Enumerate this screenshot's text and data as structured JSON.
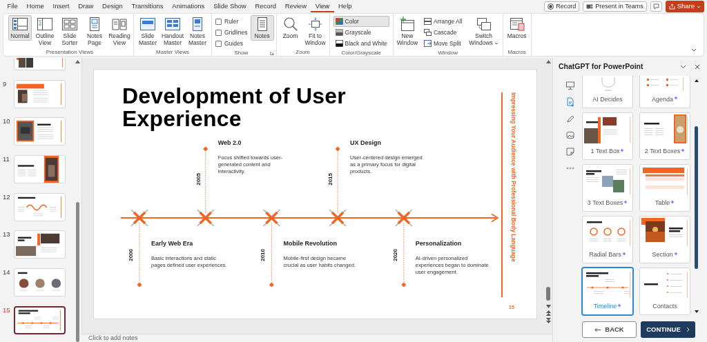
{
  "menu_tabs": [
    {
      "label": "File",
      "selected": false
    },
    {
      "label": "Home",
      "selected": false
    },
    {
      "label": "Insert",
      "selected": false
    },
    {
      "label": "Draw",
      "selected": false
    },
    {
      "label": "Design",
      "selected": false
    },
    {
      "label": "Transitions",
      "selected": false
    },
    {
      "label": "Animations",
      "selected": false
    },
    {
      "label": "Slide Show",
      "selected": false
    },
    {
      "label": "Record",
      "selected": false
    },
    {
      "label": "Review",
      "selected": false
    },
    {
      "label": "View",
      "selected": true
    },
    {
      "label": "Help",
      "selected": false
    }
  ],
  "title_actions": [
    {
      "kind": "record",
      "label": "Record"
    },
    {
      "kind": "teams",
      "label": "Present in Teams"
    },
    {
      "kind": "comment"
    },
    {
      "kind": "share",
      "label": "Share"
    }
  ],
  "ribbon": [
    {
      "label": "Presentation Views",
      "items": [
        {
          "kind": "large",
          "label": "Normal",
          "selected": true
        },
        {
          "kind": "large",
          "label": "Outline View",
          "selected": false
        },
        {
          "kind": "large",
          "label": "Slide Sorter",
          "selected": false
        },
        {
          "kind": "large",
          "label": "Notes Page",
          "selected": false
        },
        {
          "kind": "large",
          "label": "Reading View",
          "selected": false
        }
      ]
    },
    {
      "label": "Master Views",
      "items": [
        {
          "kind": "large",
          "label": "Slide Master",
          "selected": false
        },
        {
          "kind": "large",
          "label": "Handout Master",
          "selected": false
        },
        {
          "kind": "large",
          "label": "Notes Master",
          "selected": false
        }
      ]
    },
    {
      "label": "Show",
      "launcher": true,
      "items": [
        {
          "kind": "check",
          "label": "Ruler",
          "checked": false
        },
        {
          "kind": "check",
          "label": "Gridlines",
          "checked": false
        },
        {
          "kind": "check",
          "label": "Guides",
          "checked": false
        },
        {
          "kind": "large",
          "label": "Notes",
          "selected": true
        }
      ]
    },
    {
      "label": "Zoom",
      "items": [
        {
          "kind": "large",
          "label": "Zoom",
          "selected": false
        },
        {
          "kind": "large",
          "label": "Fit to Window",
          "selected": false
        }
      ]
    },
    {
      "label": "Color/Grayscale",
      "items": [
        {
          "kind": "small",
          "label": "Color",
          "selected": true
        },
        {
          "kind": "small",
          "label": "Grayscale",
          "selected": false
        },
        {
          "kind": "small",
          "label": "Black and White",
          "selected": false
        }
      ]
    },
    {
      "label": "Window",
      "items": [
        {
          "kind": "large",
          "label": "New Window",
          "selected": false
        },
        {
          "kind": "small",
          "label": "Arrange All",
          "selected": false
        },
        {
          "kind": "small",
          "label": "Cascade",
          "selected": false
        },
        {
          "kind": "small",
          "label": "Move Split",
          "selected": false
        },
        {
          "kind": "large",
          "label": "Switch Windows",
          "selected": false,
          "dropdown": true
        }
      ]
    },
    {
      "label": "Macros",
      "items": [
        {
          "kind": "large",
          "label": "Macros",
          "selected": false
        }
      ]
    }
  ],
  "slides": [
    {
      "number": "9",
      "selected": false
    },
    {
      "number": "10",
      "selected": false
    },
    {
      "number": "11",
      "selected": false
    },
    {
      "number": "12",
      "selected": false
    },
    {
      "number": "13",
      "selected": false
    },
    {
      "number": "14",
      "selected": false
    },
    {
      "number": "15",
      "selected": true
    }
  ],
  "slide": {
    "title": "Development of User Experience",
    "side_text": "Impressing Your Audience with Professional Body Language",
    "page_number": "15",
    "events": [
      {
        "year": "2000",
        "title": "Early Web Era",
        "text": "Basic interactions and static pages defined user experiences."
      },
      {
        "year": "2005",
        "title": "Web 2.0",
        "text": "Focus shifted towards user-generated content and interactivity."
      },
      {
        "year": "2010",
        "title": "Mobile Revolution",
        "text": "Mobile-first design became crucial as user habits changed."
      },
      {
        "year": "2015",
        "title": "UX Design",
        "text": "User-centered design emerged as a primary focus for digital products."
      },
      {
        "year": "2020",
        "title": "Personalization",
        "text": "AI-driven personalized experiences began to dominate user engagement."
      }
    ]
  },
  "notes": {
    "placeholder": "Click to add notes"
  },
  "panel": {
    "title": "ChatGPT for PowerPoint",
    "tools": [
      {
        "selected": false
      },
      {
        "selected": true
      },
      {
        "selected": false
      },
      {
        "selected": false
      },
      {
        "selected": false
      },
      {
        "selected": false
      }
    ],
    "layouts": [
      {
        "label": "AI Decides",
        "premium": false,
        "selected": false
      },
      {
        "label": "Agenda",
        "premium": true,
        "selected": false
      },
      {
        "label": "1 Text Box",
        "premium": true,
        "selected": false
      },
      {
        "label": "2 Text Boxes",
        "premium": true,
        "selected": false
      },
      {
        "label": "3 Text Boxes",
        "premium": true,
        "selected": false
      },
      {
        "label": "Table",
        "premium": true,
        "selected": false
      },
      {
        "label": "Radial Bars",
        "premium": true,
        "selected": false
      },
      {
        "label": "Section",
        "premium": true,
        "selected": false
      },
      {
        "label": "Timeline",
        "premium": true,
        "selected": true
      },
      {
        "label": "Contacts",
        "premium": false,
        "selected": false
      }
    ],
    "buttons": [
      {
        "kind": "back",
        "label": "BACK"
      },
      {
        "kind": "continue",
        "label": "CONTINUE"
      }
    ]
  }
}
